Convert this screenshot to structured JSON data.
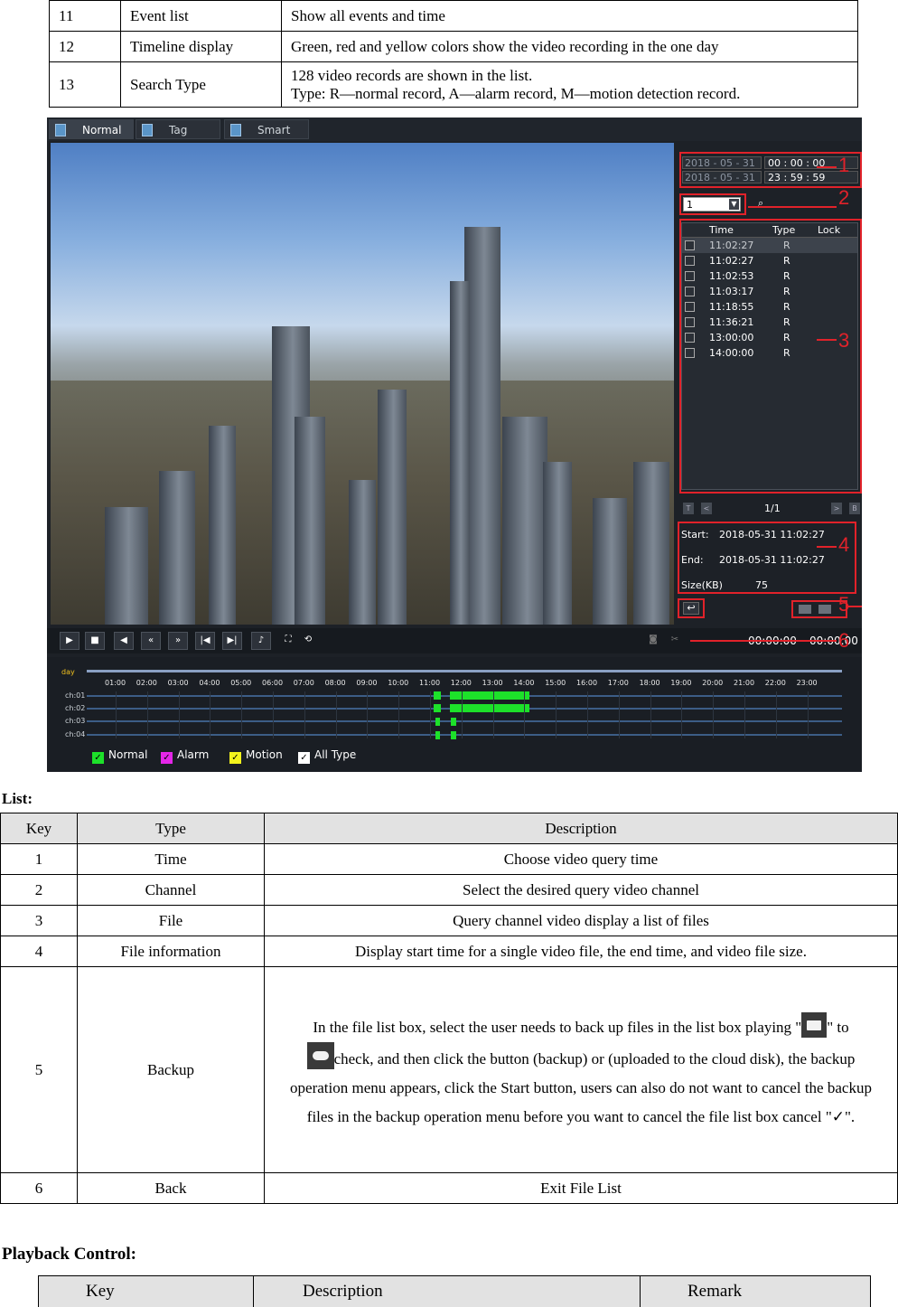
{
  "top_table": {
    "rows": [
      {
        "key": "11",
        "type": "Event list",
        "desc": "Show all events and time"
      },
      {
        "key": "12",
        "type": "Timeline display",
        "desc": "Green, red and yellow colors show the video recording in the one day"
      },
      {
        "key": "13",
        "type": "Search Type",
        "desc_line1": "128 video records are shown in the list.",
        "desc_line2": "Type: R—normal record, A—alarm record, M—motion detection record."
      }
    ]
  },
  "screenshot": {
    "tabs": [
      "Normal",
      "Tag",
      "Smart"
    ],
    "time_range": {
      "start_date_year": "2018",
      "start_date_rest": " - 05 - 31",
      "start_time": "00 :  00 :  00",
      "end_date_year": "2018",
      "end_date_rest": " - 05 - 31",
      "end_time": "23 :  59 :  59"
    },
    "channel": "1",
    "file_list": {
      "headers": [
        "Time",
        "Type",
        "Lock"
      ],
      "rows": [
        {
          "time": "11:02:27",
          "type": "R"
        },
        {
          "time": "11:02:27",
          "type": "R"
        },
        {
          "time": "11:02:53",
          "type": "R"
        },
        {
          "time": "11:03:17",
          "type": "R"
        },
        {
          "time": "11:18:55",
          "type": "R"
        },
        {
          "time": "11:36:21",
          "type": "R"
        },
        {
          "time": "13:00:00",
          "type": "R"
        },
        {
          "time": "14:00:00",
          "type": "R"
        }
      ]
    },
    "pager": {
      "first": "T",
      "prev": "<",
      "page": "1/1",
      "next": ">",
      "last": "B"
    },
    "file_info": {
      "start_label": "Start:",
      "start_value": "2018-05-31 11:02:27",
      "end_label": "End:",
      "end_value": "2018-05-31 11:02:27",
      "size_label": "Size(KB)",
      "size_value": "75"
    },
    "play_time": "00:00:00",
    "total_time": "00:00:00",
    "timeline": {
      "day_label": "day",
      "hours": [
        "01:00",
        "02:00",
        "03:00",
        "04:00",
        "05:00",
        "06:00",
        "07:00",
        "08:00",
        "09:00",
        "10:00",
        "11:00",
        "12:00",
        "13:00",
        "14:00",
        "15:00",
        "16:00",
        "17:00",
        "18:00",
        "19:00",
        "20:00",
        "21:00",
        "22:00",
        "23:00"
      ],
      "channels": [
        "ch:01",
        "ch:02",
        "ch:03",
        "ch:04"
      ],
      "legend": [
        "Normal",
        "Alarm",
        "Motion",
        "All Type"
      ],
      "legend_colors": [
        "#1de12a",
        "#e426e8",
        "#f3f31c",
        "#ffffff"
      ]
    },
    "callouts": [
      "1",
      "2",
      "3",
      "4",
      "5",
      "6"
    ],
    "accent_color": "#e1222a"
  },
  "list_section": {
    "title": "List:",
    "headers": [
      "Key",
      "Type",
      "Description"
    ],
    "rows": [
      {
        "key": "1",
        "type": "Time",
        "desc": "Choose video query time"
      },
      {
        "key": "2",
        "type": "Channel",
        "desc": "Select the desired query video channel"
      },
      {
        "key": "3",
        "type": "File",
        "desc": "Query channel video display a list of files"
      },
      {
        "key": "4",
        "type": "File information",
        "desc": "Display start time for a single video file, the end time, and video file size."
      },
      {
        "key": "5",
        "type": "Backup",
        "desc_a": "In the file list box, select the user needs to back up files in the list box playing \"",
        "desc_b": "\" to",
        "desc_c": "check, and then click the button (backup) or (uploaded to the cloud disk), the backup operation menu appears, click the Start button, users can also do not want to cancel the backup files in the backup operation menu before you want to cancel the file list box cancel \"✓\"."
      },
      {
        "key": "6",
        "type": "Back",
        "desc": "Exit File List"
      }
    ]
  },
  "playback_section": {
    "title": "Playback Control:",
    "headers": [
      "Key",
      "Description",
      "Remark"
    ]
  }
}
